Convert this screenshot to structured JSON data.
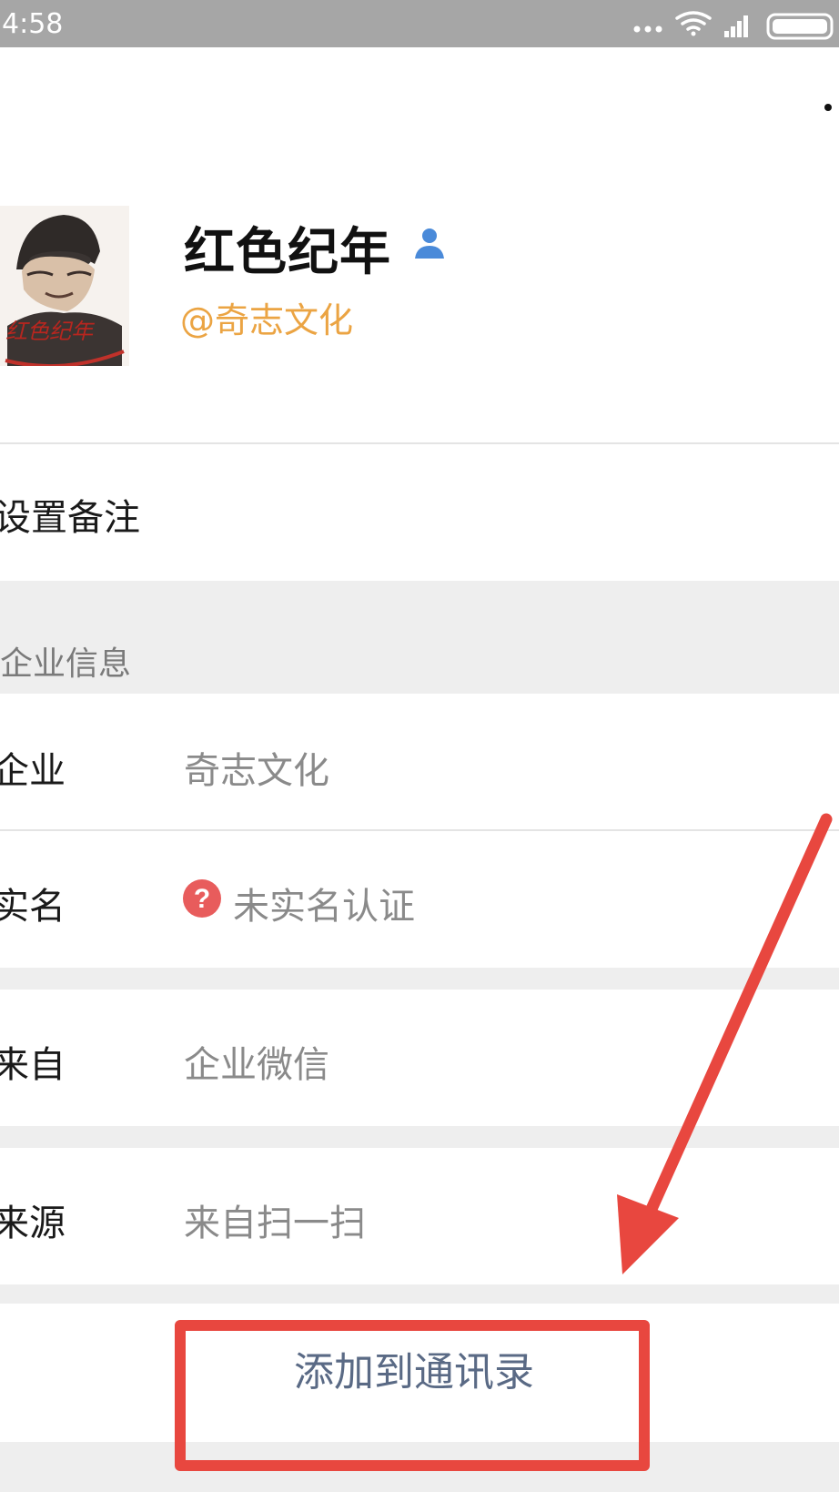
{
  "status_bar": {
    "time": "4:58"
  },
  "profile": {
    "name": "红色纪年",
    "handle": "@奇志文化",
    "avatar_caption": "红色纪年"
  },
  "set_remark": {
    "label": "设置备注"
  },
  "enterprise_section": {
    "header": "企业信息"
  },
  "rows": [
    {
      "label": "企业",
      "value": "奇志文化"
    },
    {
      "label": "实名",
      "value": "未实名认证"
    },
    {
      "label": "来自",
      "value": "企业微信"
    },
    {
      "label": "来源",
      "value": "来自扫一扫"
    }
  ],
  "add_button": {
    "label": "添加到通讯录"
  },
  "colors": {
    "handle": "#eba443",
    "annotation": "#e8473f",
    "button_text": "#5a6a85",
    "verified": "#4a8ad9"
  }
}
